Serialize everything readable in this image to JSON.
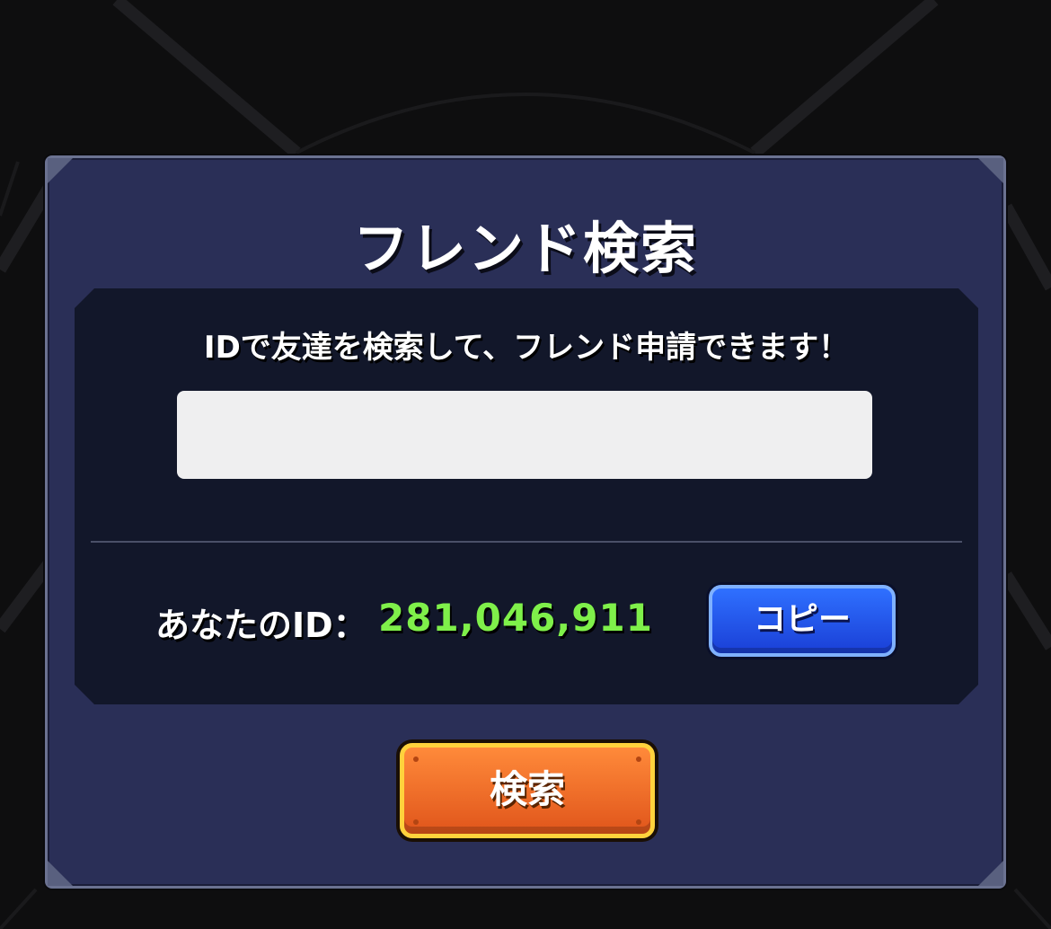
{
  "dialog": {
    "title": "フレンド検索",
    "instructions": "IDで友達を検索して、フレンド申請できます！",
    "id_input": {
      "value": "",
      "placeholder": ""
    },
    "your_id_label": "あなたのID：",
    "your_id_value": "281,046,911",
    "copy_label": "コピー",
    "search_label": "検索"
  },
  "colors": {
    "dialog_bg": "#2a2f57",
    "panel_bg": "#12172a",
    "id_value": "#7ff04a",
    "copy_button": "#2f70ff",
    "search_button": "#ff8a3a",
    "search_button_border": "#ffd23c"
  }
}
